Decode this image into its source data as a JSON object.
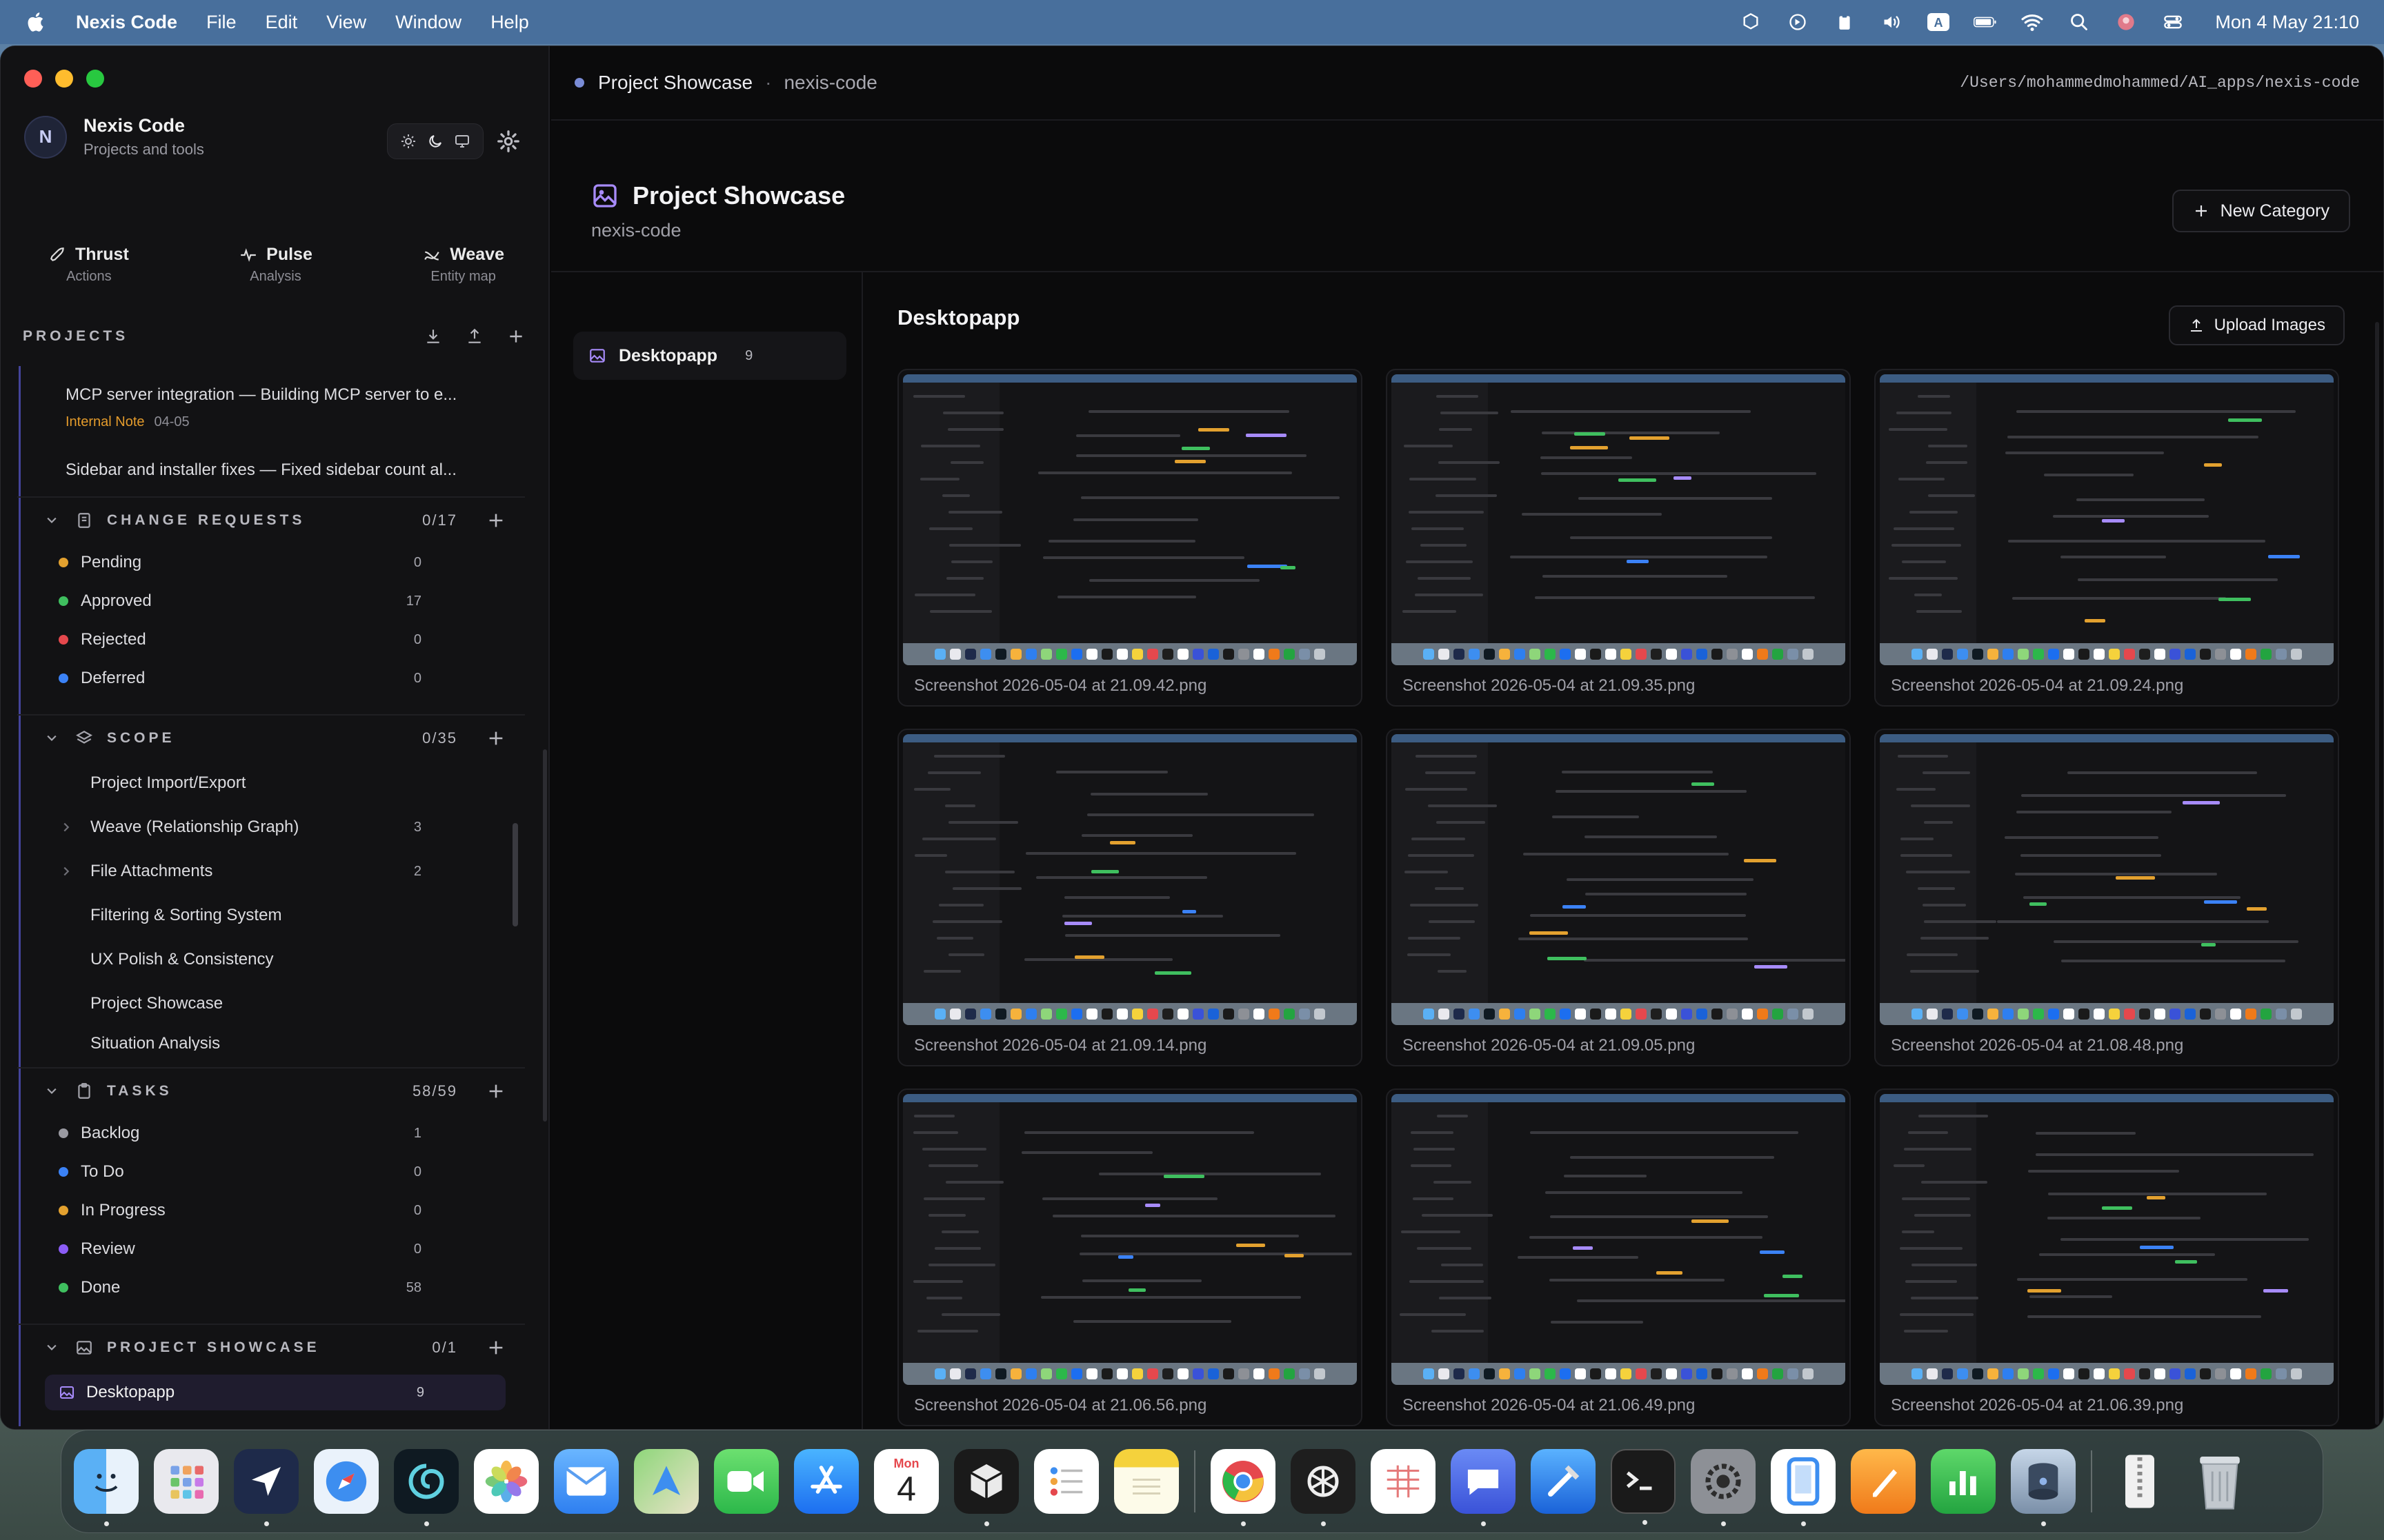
{
  "menubar": {
    "app_name": "Nexis Code",
    "menus": [
      "File",
      "Edit",
      "View",
      "Window",
      "Help"
    ],
    "clock": "Mon 4 May  21:10"
  },
  "sidebar": {
    "brand_initial": "N",
    "brand_title": "Nexis Code",
    "brand_sub": "Projects and tools",
    "modes": [
      {
        "label": "Thrust",
        "sub": "Actions"
      },
      {
        "label": "Pulse",
        "sub": "Analysis"
      },
      {
        "label": "Weave",
        "sub": "Entity map"
      }
    ],
    "projects_title": "PROJECTS",
    "notes": [
      {
        "title": "MCP server integration — Building MCP server to e...",
        "tag": "Internal Note",
        "date": "04-05"
      },
      {
        "title": "Sidebar and installer fixes — Fixed sidebar count al..."
      }
    ],
    "change_requests": {
      "title": "CHANGE REQUESTS",
      "count": "0/17",
      "items": [
        {
          "label": "Pending",
          "num": "0",
          "color": "#e3a12f"
        },
        {
          "label": "Approved",
          "num": "17",
          "color": "#3fbf5f"
        },
        {
          "label": "Rejected",
          "num": "0",
          "color": "#e5484d"
        },
        {
          "label": "Deferred",
          "num": "0",
          "color": "#3b82f6"
        }
      ]
    },
    "scope": {
      "title": "SCOPE",
      "count": "0/35",
      "items": [
        {
          "label": "Project Import/Export",
          "num": ""
        },
        {
          "label": "Weave (Relationship Graph)",
          "num": "3"
        },
        {
          "label": "File Attachments",
          "num": "2"
        },
        {
          "label": "Filtering & Sorting System",
          "num": ""
        },
        {
          "label": "UX Polish & Consistency",
          "num": ""
        },
        {
          "label": "Project Showcase",
          "num": ""
        },
        {
          "label": "Situation Analysis",
          "num": ""
        }
      ]
    },
    "tasks": {
      "title": "TASKS",
      "count": "58/59",
      "items": [
        {
          "label": "Backlog",
          "num": "1",
          "color": "#9a9aa2"
        },
        {
          "label": "To Do",
          "num": "0",
          "color": "#3b82f6"
        },
        {
          "label": "In Progress",
          "num": "0",
          "color": "#e3a12f"
        },
        {
          "label": "Review",
          "num": "0",
          "color": "#8b5cf6"
        },
        {
          "label": "Done",
          "num": "58",
          "color": "#3fbf5f"
        }
      ]
    },
    "showcase": {
      "title": "PROJECT SHOWCASE",
      "count": "0/1",
      "selected_label": "Desktopapp",
      "selected_num": "9"
    }
  },
  "main": {
    "breadcrumb": "Project Showcase",
    "breadcrumb_sub": "nexis-code",
    "path": "/Users/mohammedmohammed/AI_apps/nexis-code",
    "title": "Project Showcase",
    "subtitle": "nexis-code",
    "new_category_label": "New Category",
    "category": {
      "label": "Desktopapp",
      "num": "9"
    },
    "gallery_title": "Desktopapp",
    "upload_label": "Upload Images",
    "images": [
      "Screenshot 2026-05-04 at 21.09.42.png",
      "Screenshot 2026-05-04 at 21.09.35.png",
      "Screenshot 2026-05-04 at 21.09.24.png",
      "Screenshot 2026-05-04 at 21.09.14.png",
      "Screenshot 2026-05-04 at 21.09.05.png",
      "Screenshot 2026-05-04 at 21.08.48.png",
      "Screenshot 2026-05-04 at 21.06.56.png",
      "Screenshot 2026-05-04 at 21.06.49.png",
      "Screenshot 2026-05-04 at 21.06.39.png"
    ]
  },
  "dock": {
    "calendar_month": "Mon",
    "calendar_day": "4",
    "apps": [
      "finder-icon",
      "launchpad-icon",
      "navigation-app-icon",
      "safari-icon",
      "swirl-app-icon",
      "photos-icon",
      "mail-icon",
      "maps-icon",
      "facetime-icon",
      "app-store-icon",
      "calendar-icon",
      "cube-app-icon",
      "reminders-icon",
      "notes-icon",
      "chrome-icon",
      "chatgpt-icon",
      "sheet-app-icon",
      "chat-bubble-icon",
      "xcode-icon",
      "terminal-icon",
      "system-settings-icon",
      "phone-frame-icon",
      "pages-icon",
      "numbers-icon",
      "disk-utility-icon",
      "archive-icon",
      "trash-icon"
    ]
  }
}
